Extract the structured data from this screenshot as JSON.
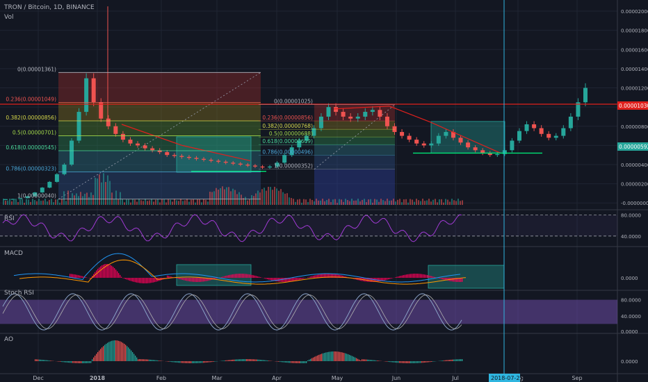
{
  "colors": {
    "bg": "#131722",
    "grid": "#1f2433",
    "text": "#b2b5be",
    "up": "#26a69a",
    "down": "#ef5350",
    "red_line": "#e0201d",
    "green_line": "#00e676",
    "blue_line": "#2fb6e0",
    "rsi": "#a23bd6",
    "macd": "#2196f3",
    "signal": "#ff9800",
    "hist": "#f50057",
    "stoch_k": "#8aa2c8",
    "stoch_d": "#b0b0b0"
  },
  "header": {
    "symbol": "TRON / Bitcoin, 1D, BINANCE",
    "vol_label": "Vol"
  },
  "price_axis": {
    "labels": [
      "0.00002000",
      "0.00001800",
      "0.00001600",
      "0.00001400",
      "0.00001200",
      "0.00001000",
      "0.00000800",
      "0.00000600",
      "0.00000400",
      "0.00000200",
      "-0.00000000"
    ],
    "current_price": "0.00001030",
    "marker_green": "0.00000592"
  },
  "x_axis": {
    "labels": [
      "Dec",
      "2018",
      "Feb",
      "Mar",
      "Apr",
      "May",
      "Jun",
      "Jul",
      "Aug",
      "Sep"
    ],
    "crosshair_date": "2018-07-25"
  },
  "panes": {
    "rsi": {
      "label": "RSI",
      "levels": [
        "80.0000",
        "40.0000"
      ]
    },
    "macd": {
      "label": "MACD",
      "levels": [
        "0.0000"
      ]
    },
    "stoch": {
      "label": "Stoch RSI",
      "levels": [
        "80.0000",
        "40.0000",
        "0.0000"
      ]
    },
    "ao": {
      "label": "AO",
      "levels": [
        "0.0000"
      ]
    }
  },
  "fib1": {
    "labels": [
      {
        "text": "0(0.00001361)",
        "value": 1.361e-05
      },
      {
        "text": "0.236(0.00001049)",
        "value": 1.049e-05
      },
      {
        "text": "0.382(0.00000856)",
        "value": 8.56e-06
      },
      {
        "text": "0.5(0.00000701)",
        "value": 7.01e-06
      },
      {
        "text": "0.618(0.00000545)",
        "value": 5.45e-06
      },
      {
        "text": "0.786(0.00000323)",
        "value": 3.23e-06
      },
      {
        "text": "1(0.00000040)",
        "value": 4e-07
      }
    ]
  },
  "fib2": {
    "labels": [
      {
        "text": "0(0.00001025)",
        "value": 1.025e-05
      },
      {
        "text": "0.236(0.00000856)",
        "value": 8.56e-06
      },
      {
        "text": "0.382(0.00000768)",
        "value": 7.68e-06
      },
      {
        "text": "0.5(0.00000688)",
        "value": 6.88e-06
      },
      {
        "text": "0.618(0.00000609)",
        "value": 6.09e-06
      },
      {
        "text": "0.786(0.00000496)",
        "value": 4.96e-06
      },
      {
        "text": "1(0.00000352)",
        "value": 3.52e-06
      }
    ]
  },
  "chart_data": {
    "type": "line",
    "title": "TRON / Bitcoin, 1D, BINANCE",
    "x_ticks": [
      "Dec",
      "2018",
      "Feb",
      "Mar",
      "Apr",
      "May",
      "Jun",
      "Jul",
      "Aug",
      "Sep"
    ],
    "y_range": [
      0,
      2.05e-05
    ],
    "horizontal_lines": [
      1.03e-05
    ],
    "series": [
      {
        "values": [
          4e-07,
          4.2e-07,
          5e-07,
          7e-07,
          1.1e-06,
          1.6e-06,
          2.2e-06,
          3e-06,
          4e-06,
          6.5e-06,
          9.5e-06,
          1.3e-05,
          1.05e-05,
          8.8e-06,
          8e-06,
          7.2e-06,
          6.6e-06,
          6.2e-06,
          6e-06,
          5.7e-06,
          5.5e-06,
          5.3e-06,
          5e-06,
          4.9e-06,
          4.8e-06,
          4.7e-06,
          4.6e-06,
          4.5e-06,
          4.4e-06,
          4.3e-06,
          4.2e-06,
          4.1e-06,
          4e-06,
          3.9e-06,
          3.8e-06,
          3.7e-06,
          3.8e-06,
          4.2e-06,
          5e-06,
          5.8e-06,
          6.5e-06,
          7e-06,
          7.8e-06,
          9e-06,
          1e-05,
          9.5e-06,
          9e-06,
          8.8e-06,
          9e-06,
          9.5e-06,
          9.7e-06,
          9e-06,
          8e-06,
          7.4e-06,
          7e-06,
          6.6e-06,
          6.2e-06,
          6e-06,
          6.2e-06,
          7e-06,
          7.4e-06,
          6.8e-06,
          6.3e-06,
          5.8e-06,
          5.5e-06,
          5.2e-06,
          5e-06,
          5.1e-06,
          5.5e-06,
          6.5e-06,
          7.5e-06,
          8.2e-06,
          7.8e-06,
          7.2e-06,
          6.8e-06,
          7e-06,
          7.8e-06,
          9e-06,
          1.05e-05,
          1.2e-05
        ]
      }
    ]
  }
}
